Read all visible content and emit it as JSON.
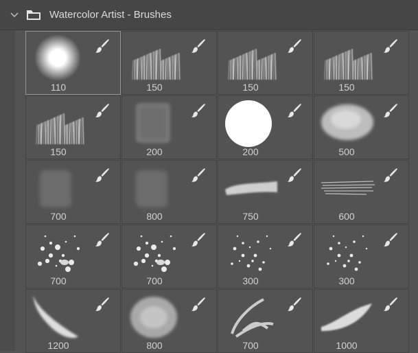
{
  "panel": {
    "group_title": "Watercolor Artist - Brushes",
    "icons": {
      "expand": "chevron-down-icon",
      "group": "folder-icon",
      "brush": "paintbrush-icon"
    },
    "colors": {
      "background": "#535353",
      "header": "#464646",
      "selection": "#49a4e8",
      "text": "#d2d2d2"
    }
  },
  "brushes": [
    {
      "size": "110",
      "preview": "soft-round",
      "selected": true
    },
    {
      "size": "150",
      "preview": "bristle-streaks"
    },
    {
      "size": "150",
      "preview": "bristle-streaks"
    },
    {
      "size": "150",
      "preview": "bristle-streaks"
    },
    {
      "size": "150",
      "preview": "bristle-streaks"
    },
    {
      "size": "200",
      "preview": "wash-square"
    },
    {
      "size": "200",
      "preview": "hard-round"
    },
    {
      "size": "500",
      "preview": "cloud-wash"
    },
    {
      "size": "700",
      "preview": "faint-wash"
    },
    {
      "size": "800",
      "preview": "faint-wash"
    },
    {
      "size": "750",
      "preview": "dry-stroke"
    },
    {
      "size": "600",
      "preview": "horizontal-lines"
    },
    {
      "size": "700",
      "preview": "splatter"
    },
    {
      "size": "700",
      "preview": "splatter"
    },
    {
      "size": "300",
      "preview": "splatter-light"
    },
    {
      "size": "300",
      "preview": "splatter-light"
    },
    {
      "size": "1200",
      "preview": "diagonal-wash"
    },
    {
      "size": "800",
      "preview": "round-wash"
    },
    {
      "size": "700",
      "preview": "swirl-stroke"
    },
    {
      "size": "1000",
      "preview": "swoosh-stroke"
    }
  ]
}
